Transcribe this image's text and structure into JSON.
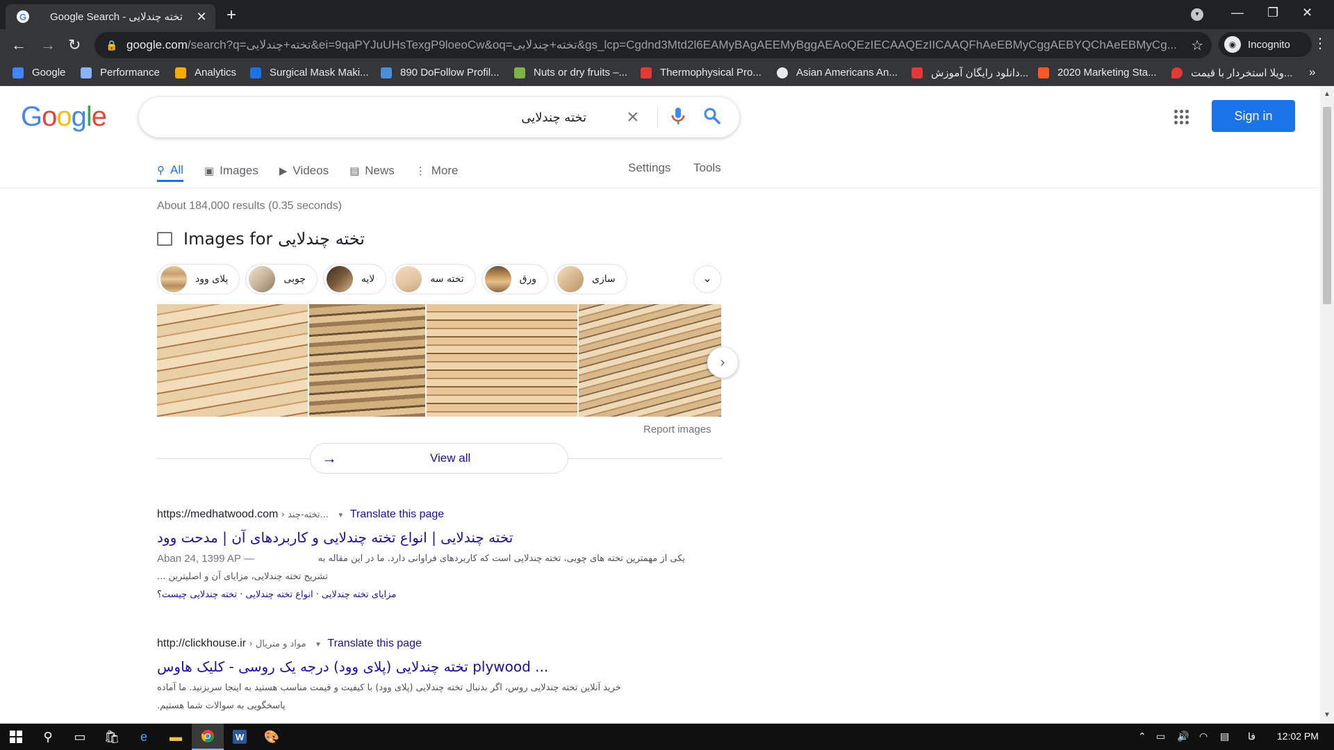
{
  "browser": {
    "tab_title": "Google Search - تخته چندلایی",
    "url_host": "google.com",
    "url_rest": "/search?q=تخته+چندلایی&ei=9qaPYJuUHsTexgP9loeoCw&oq=تخته+چندلایی&gs_lcp=Cgdnd3Mtd2l6EAMyBAgAEEMyBggAEAoQEzIECAAQEzIICAAQFhAeEBMyCggAEBYQChAeEBMyCg...",
    "incognito_label": "Incognito",
    "bookmarks": [
      {
        "label": "Google",
        "color": "#4285f4"
      },
      {
        "label": "Performance",
        "color": "#8ab4f8"
      },
      {
        "label": "Analytics",
        "color": "#f9ab00"
      },
      {
        "label": "Surgical Mask Maki...",
        "color": "#1a73e8"
      },
      {
        "label": "890 DoFollow Profil...",
        "color": "#4a90d9"
      },
      {
        "label": "Nuts or dry fruits –...",
        "color": "#7cb342"
      },
      {
        "label": "Thermophysical Pro...",
        "color": "#e53935"
      },
      {
        "label": "Asian Americans An...",
        "color": "#e8eaed"
      },
      {
        "label": "دانلود رایگان آموزش...",
        "color": "#e53935"
      },
      {
        "label": "2020 Marketing Sta...",
        "color": "#ff5722"
      },
      {
        "label": "ویلا استخردار با قیمت...",
        "color": "#e53935"
      }
    ]
  },
  "google": {
    "logo_letters": [
      "G",
      "o",
      "o",
      "g",
      "l",
      "e"
    ],
    "logo_colors": [
      "#4285f4",
      "#ea4335",
      "#fbbc05",
      "#4285f4",
      "#34a853",
      "#ea4335"
    ],
    "query": "تخته چندلایی",
    "signin_label": "Sign in",
    "tabs": [
      {
        "label": "All",
        "icon": "search-icon"
      },
      {
        "label": "Images",
        "icon": "image-icon"
      },
      {
        "label": "Videos",
        "icon": "video-icon"
      },
      {
        "label": "News",
        "icon": "news-icon"
      },
      {
        "label": "More",
        "icon": "more-icon"
      }
    ],
    "settings_label": "Settings",
    "tools_label": "Tools",
    "result_stats": "About 184,000 results (0.35 seconds)",
    "images_title": "Images for تخته چندلایی",
    "chips": [
      "پلای وود",
      "چوبی",
      "لایه",
      "تخته سه",
      "ورق",
      "سازی"
    ],
    "report_images": "Report images",
    "view_all": "View all",
    "results": [
      {
        "site": "https://medhatwood.com",
        "crumb": "› تخته-چند...",
        "translate": "Translate this page",
        "title": "تخته چندلایی | انواع تخته چندلایی و کاربردهای آن | مدحت وود",
        "date": "Aban 24, 1399 AP —",
        "snippet_line1": "یکی از مهمترین تخته های چوبی، تخته چندلایی است که کاربردهای فراوانی دارد. ما در این مقاله به",
        "snippet_line2": "تشریح تخته چندلایی، مزایای آن و اصلیترین ...",
        "sitelinks": "مزایای تخته چندلایی · انواع تخته چندلایی · تخته چندلایی چیست؟"
      },
      {
        "site": "http://clickhouse.ir",
        "crumb": "› مواد و متریال",
        "translate": "Translate this page",
        "title": "تخته چندلایی (پلای وود) درجه یک روسی - کلیک هاوس plywood ...",
        "snippet_line1": "خرید آنلاین تخته چندلایی روس، اگر بدنبال تخته چندلایی (پلای وود) با کیفیت و قیمت مناسب هستید به اینجا سربزنید. ما آماده",
        "snippet_line2": "پاسخگویی به سوالات شما هستیم."
      }
    ]
  },
  "taskbar": {
    "language": "فا",
    "clock": "12:02 PM"
  }
}
